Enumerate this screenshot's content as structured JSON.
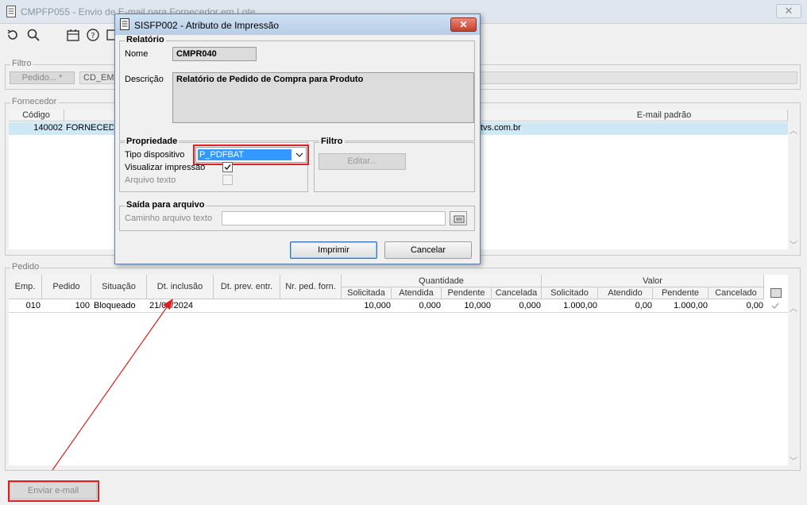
{
  "main": {
    "title": "CMPFP055 - Envio de E-mail para Fornecedor em Lote",
    "close_label": "✕",
    "filtro": {
      "label": "Filtro",
      "pedido_button": "Pedido... *",
      "cd_value": "CD_EMP"
    },
    "fornecedor": {
      "label": "Fornecedor",
      "col_codigo": "Código",
      "col_email": "E-mail padrão",
      "row_codigo": "140002",
      "row_nome": "FORNECEDO",
      "row_email": "tvs.com.br"
    },
    "pedido": {
      "label": "Pedido",
      "headers": {
        "emp": "Emp.",
        "pedido": "Pedido",
        "situacao": "Situação",
        "dt_inclusao": "Dt. inclusão",
        "dt_prev": "Dt. prev. entr.",
        "nr_ped": "Nr. ped. forn.",
        "quantidade": "Quantidade",
        "valor": "Valor",
        "solicitada": "Solicitada",
        "atendida": "Atendida",
        "pendente_q": "Pendente",
        "cancelada": "Cancelada",
        "solicitado": "Solicitado",
        "atendido": "Atendido",
        "pendente_v": "Pendente",
        "cancelado": "Cancelado"
      },
      "row": {
        "emp": "010",
        "pedido": "100",
        "situacao": "Bloqueado",
        "dt_inclusao": "21/08/2024",
        "solicitada": "10,000",
        "atendida": "0,000",
        "pendente_q": "10,000",
        "cancelada": "0,000",
        "solicitado": "1.000,00",
        "atendido": "0,00",
        "pendente_v": "1.000,00",
        "cancelado": "0,00"
      }
    },
    "enviar_button": "Enviar e-mail"
  },
  "dialog": {
    "title": "SISFP002 - Atributo de Impressão",
    "close_label": "✕",
    "relatorio": {
      "label": "Relatório",
      "nome_label": "Nome",
      "nome_value": "CMPR040",
      "descricao_label": "Descrição",
      "descricao_value": "Relatório de Pedido de Compra para Produto"
    },
    "propriedade": {
      "label": "Propriedade",
      "tipo_label": "Tipo dispositivo",
      "tipo_value": "P_PDFBAT",
      "visualizar_label": "Visualizar impressão",
      "arquivo_label": "Arquivo texto"
    },
    "filtro": {
      "label": "Filtro",
      "editar_button": "Editar..."
    },
    "saida": {
      "label": "Saída para arquivo",
      "caminho_label": "Caminho arquivo texto",
      "caminho_value": ""
    },
    "imprimir_button": "Imprimir",
    "cancelar_button": "Cancelar"
  },
  "colors": {
    "highlight": "#e02020",
    "selection": "#cfe8f5",
    "dropdown_selected": "#3399ff"
  }
}
